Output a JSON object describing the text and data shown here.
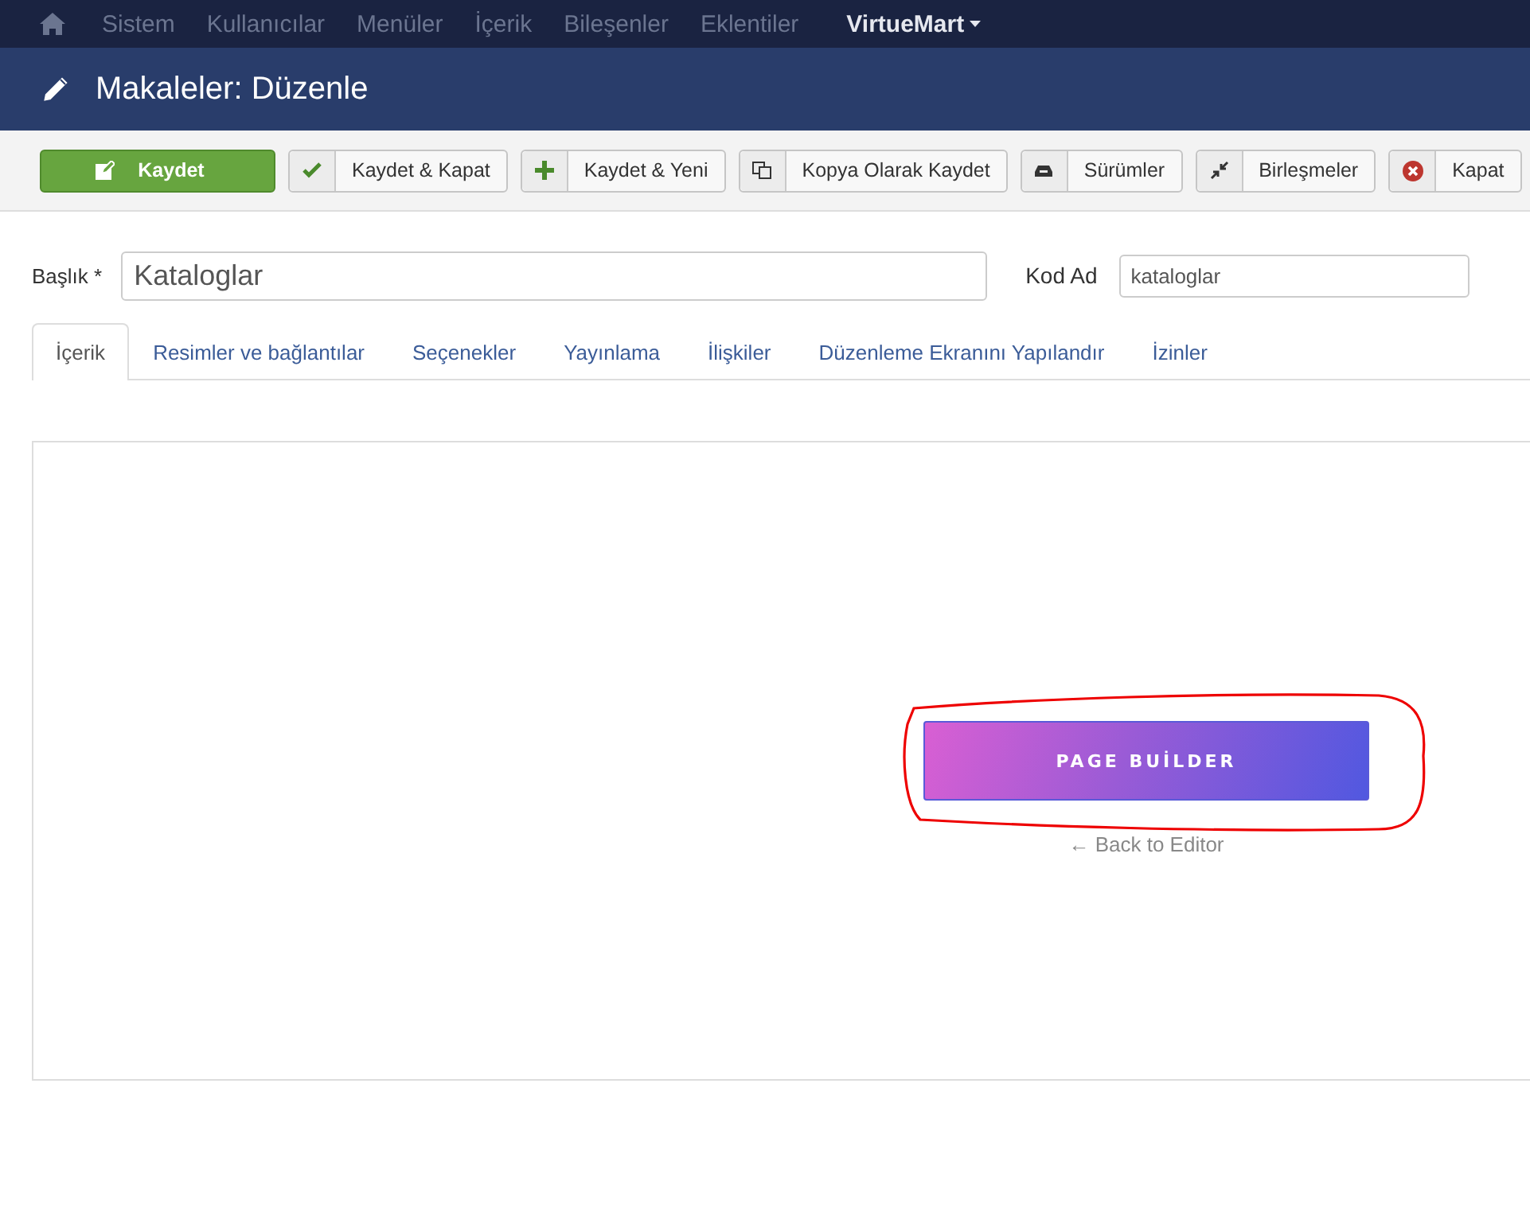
{
  "top_menu": {
    "items": [
      {
        "label": "Sistem",
        "highlighted": false
      },
      {
        "label": "Kullanıcılar",
        "highlighted": false
      },
      {
        "label": "Menüler",
        "highlighted": false
      },
      {
        "label": "İçerik",
        "highlighted": false
      },
      {
        "label": "Bileşenler",
        "highlighted": false
      },
      {
        "label": "Eklentiler",
        "highlighted": false
      },
      {
        "label": "VirtueMart",
        "highlighted": true
      }
    ]
  },
  "header": {
    "title": "Makaleler: Düzenle"
  },
  "toolbar": {
    "buttons": [
      {
        "label": "Kaydet",
        "kind": "primary"
      },
      {
        "label": "Kaydet & Kapat",
        "kind": "default"
      },
      {
        "label": "Kaydet & Yeni",
        "kind": "default"
      },
      {
        "label": "Kopya Olarak Kaydet",
        "kind": "default"
      },
      {
        "label": "Sürümler",
        "kind": "default"
      },
      {
        "label": "Birleşmeler",
        "kind": "default"
      },
      {
        "label": "Kapat",
        "kind": "default"
      }
    ]
  },
  "form": {
    "title_label": "Başlık *",
    "title_value": "Kataloglar",
    "alias_label": "Kod Ad",
    "alias_value": "kataloglar"
  },
  "tabs": [
    {
      "label": "İçerik",
      "selected": true
    },
    {
      "label": "Resimler ve bağlantılar",
      "selected": false
    },
    {
      "label": "Seçenekler",
      "selected": false
    },
    {
      "label": "Yayınlama",
      "selected": false
    },
    {
      "label": "İlişkiler",
      "selected": false
    },
    {
      "label": "Düzenleme Ekranını Yapılandır",
      "selected": false
    },
    {
      "label": "İzinler",
      "selected": false
    }
  ],
  "editor": {
    "page_builder_button": "PAGE BUİLDER",
    "back_link": "← Back to Editor"
  }
}
